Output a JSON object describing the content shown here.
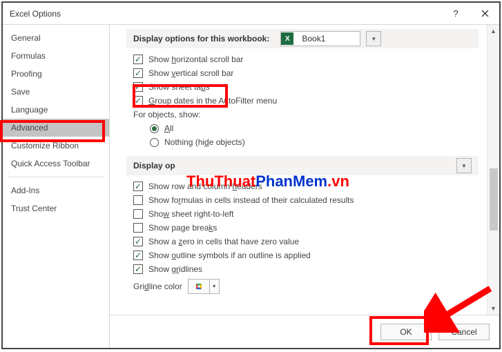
{
  "title": "Excel Options",
  "sidebar": {
    "items": [
      {
        "label": "General"
      },
      {
        "label": "Formulas"
      },
      {
        "label": "Proofing"
      },
      {
        "label": "Save"
      },
      {
        "label": "Language"
      },
      {
        "label": "Advanced",
        "selected": true
      },
      {
        "label": "Customize Ribbon"
      },
      {
        "label": "Quick Access Toolbar"
      },
      {
        "label": "Add-Ins"
      },
      {
        "label": "Trust Center"
      }
    ]
  },
  "section1": {
    "title": "Display options for this workbook:",
    "workbook": "Book1",
    "items": {
      "hscroll": "Show horizontal scroll bar",
      "vscroll": "Show vertical scroll bar",
      "tabs": "Show sheet tabs",
      "autofilter": "Group dates in the AutoFilter menu",
      "objects_label": "For objects, show:",
      "all": "All",
      "nothing": "Nothing (hide objects)"
    }
  },
  "section2": {
    "title_prefix": "Display op",
    "items": {
      "headers": "Show row and column headers",
      "formulas": "Show formulas in cells instead of their calculated results",
      "rtl": "Show sheet right-to-left",
      "pagebreaks": "Show page breaks",
      "zero": "Show a zero in cells that have zero value",
      "outline": "Show outline symbols if an outline is applied",
      "gridlines": "Show gridlines",
      "gridcolor": "Gridline color"
    }
  },
  "footer": {
    "ok": "OK",
    "cancel": "Cancel"
  },
  "watermark": {
    "t1": "ThuThuat",
    "t2": "PhanMem",
    "t3": ".vn"
  }
}
